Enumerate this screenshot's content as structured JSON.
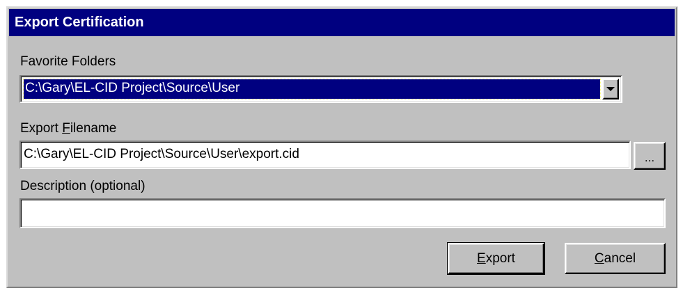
{
  "dialog": {
    "title": "Export Certification"
  },
  "favorite_folders": {
    "label": "Favorite Folders",
    "selected": "C:\\Gary\\EL-CID Project\\Source\\User"
  },
  "export_filename": {
    "label_prefix": "Export ",
    "label_accel": "F",
    "label_suffix": "ilename",
    "value": "C:\\Gary\\EL-CID Project\\Source\\User\\export.cid",
    "browse_label": "..."
  },
  "description": {
    "label": "Description (optional)",
    "value": ""
  },
  "buttons": {
    "export_accel": "E",
    "export_rest": "xport",
    "cancel_accel": "C",
    "cancel_rest": "ancel"
  },
  "colors": {
    "face": "#c0c0c0",
    "titlebar": "#000080",
    "selection": "#000080"
  },
  "icons": {
    "dropdown": "chevron-down-icon"
  }
}
